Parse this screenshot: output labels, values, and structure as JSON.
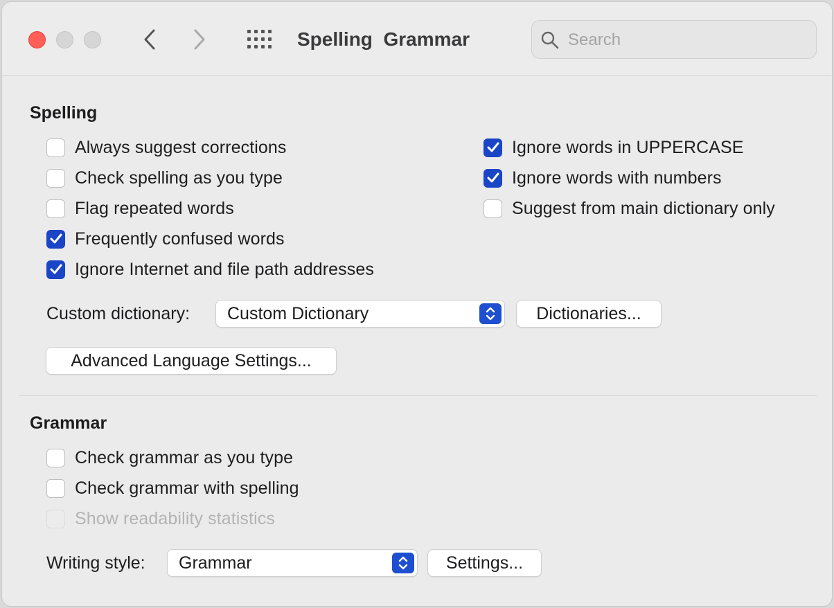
{
  "window": {
    "title": "Spelling  Grammar",
    "search_placeholder": "Search",
    "icons": {
      "close": "close-traffic-light",
      "back": "chevron-left-icon",
      "forward": "chevron-right-icon",
      "grid": "grid-icon",
      "search": "search-icon"
    },
    "colors": {
      "close": "#ff5f57",
      "accent": "#1a45c6"
    }
  },
  "spelling": {
    "title": "Spelling",
    "left_options": [
      {
        "label": "Always suggest corrections",
        "checked": false
      },
      {
        "label": "Check spelling as you type",
        "checked": false
      },
      {
        "label": "Flag repeated words",
        "checked": false
      },
      {
        "label": "Frequently confused words",
        "checked": true
      },
      {
        "label": "Ignore Internet and file path addresses",
        "checked": true
      }
    ],
    "right_options": [
      {
        "label": "Ignore words in UPPERCASE",
        "checked": true
      },
      {
        "label": "Ignore words with numbers",
        "checked": true
      },
      {
        "label": "Suggest from main dictionary only",
        "checked": false
      }
    ],
    "custom_dictionary_label": "Custom dictionary:",
    "custom_dictionary_value": "Custom Dictionary",
    "dictionaries_button": "Dictionaries...",
    "advanced_button": "Advanced Language Settings..."
  },
  "grammar": {
    "title": "Grammar",
    "options": [
      {
        "label": "Check grammar as you type",
        "checked": false,
        "disabled": false
      },
      {
        "label": "Check grammar with spelling",
        "checked": false,
        "disabled": false
      },
      {
        "label": "Show readability statistics",
        "checked": false,
        "disabled": true
      }
    ],
    "writing_style_label": "Writing style:",
    "writing_style_value": "Grammar",
    "settings_button": "Settings..."
  }
}
